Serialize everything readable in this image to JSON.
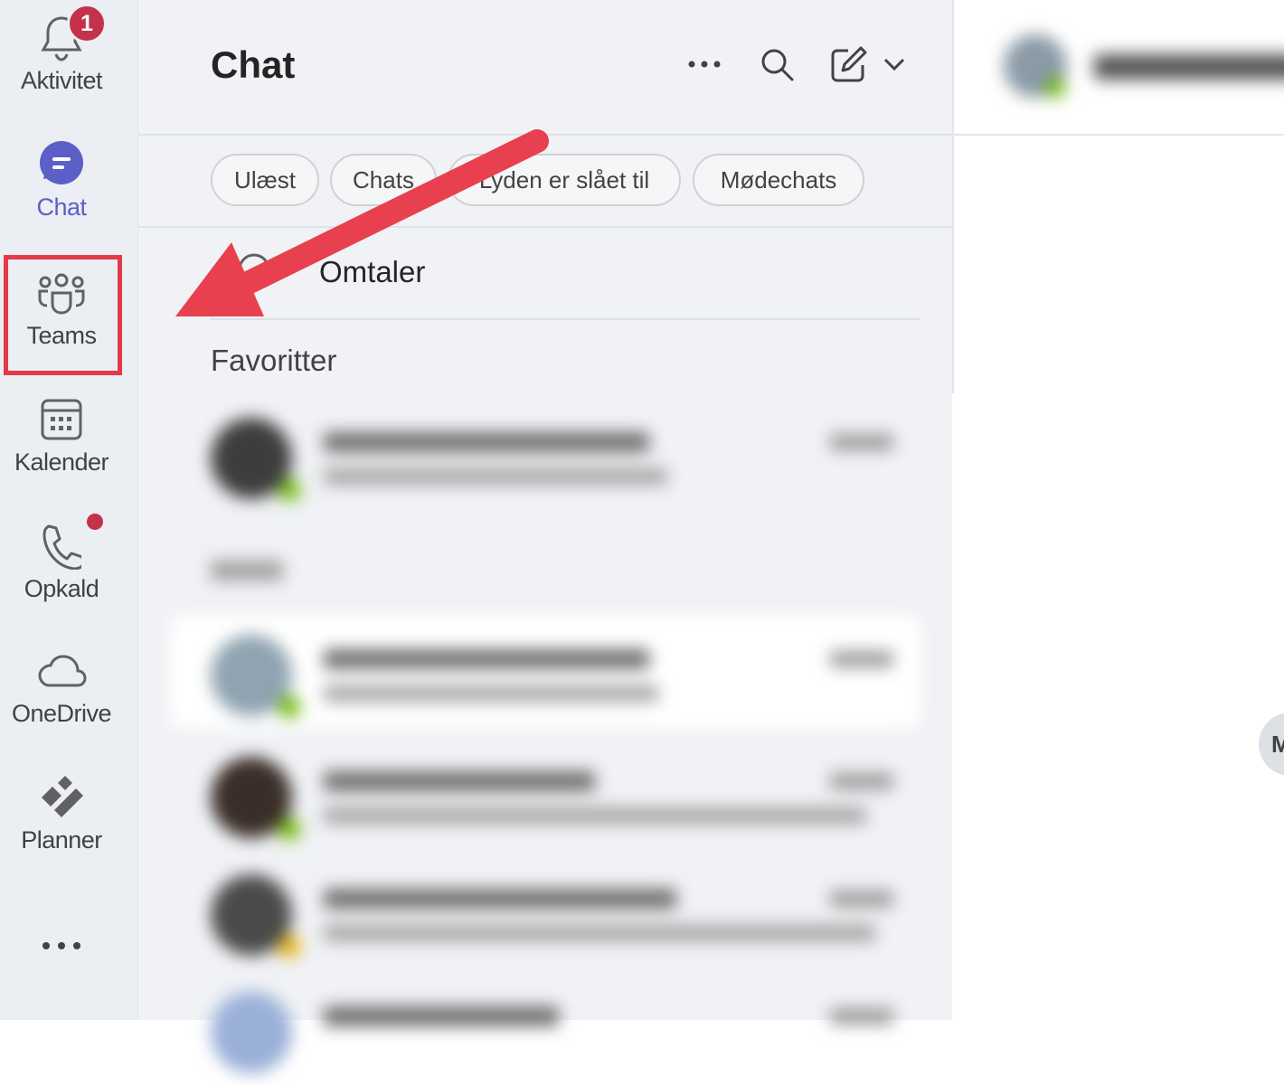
{
  "rail": {
    "items": [
      {
        "label": "Aktivitet",
        "badge": "1"
      },
      {
        "label": "Chat"
      },
      {
        "label": "Teams"
      },
      {
        "label": "Kalender"
      },
      {
        "label": "Opkald"
      },
      {
        "label": "OneDrive"
      },
      {
        "label": "Planner"
      }
    ],
    "more_icon": "more-horizontal-icon"
  },
  "pane": {
    "title": "Chat",
    "filters": [
      "Ulæst",
      "Chats",
      "Lyden er slået til",
      "Mødechats"
    ],
    "mentions_label": "Omtaler",
    "favorites_label": "Favoritter"
  },
  "right": {
    "avatar_initial": "M"
  },
  "colors": {
    "accent": "#5b5fc7",
    "badge": "#c4314b",
    "highlight": "#e33a4a",
    "presence_available": "#6bb700"
  }
}
